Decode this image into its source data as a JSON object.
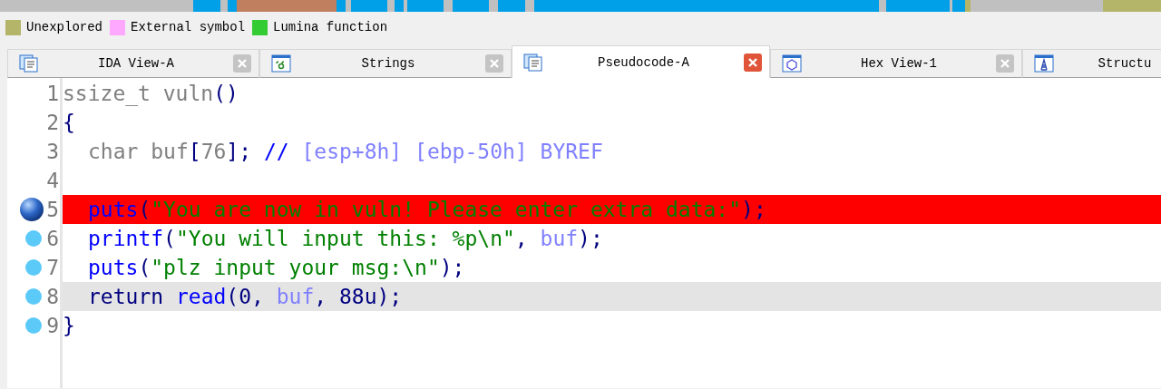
{
  "legend": [
    {
      "label": "Unexplored",
      "color": "#b5b56a"
    },
    {
      "label": "External symbol",
      "color": "#ffa8ff"
    },
    {
      "label": "Lumina function",
      "color": "#33cc33"
    }
  ],
  "tabs": [
    {
      "label": "IDA View-A",
      "kind": "listing",
      "selected": false,
      "closable": true
    },
    {
      "label": "Strings",
      "kind": "strings",
      "selected": false,
      "closable": true
    },
    {
      "label": "Pseudocode-A",
      "kind": "listing",
      "selected": true,
      "closable": true
    },
    {
      "label": "Hex View-1",
      "kind": "hex",
      "selected": false,
      "closable": true
    },
    {
      "label": "Structu",
      "kind": "structure",
      "selected": false,
      "closable": false
    }
  ],
  "code_lines": [
    {
      "number": "1",
      "kind": "plain",
      "selected": false,
      "indent": false,
      "tokens": [
        {
          "kind": "type",
          "text": "ssize_t vuln"
        },
        {
          "kind": "punct",
          "text": "()"
        }
      ]
    },
    {
      "number": "2",
      "kind": "plain",
      "selected": false,
      "indent": false,
      "tokens": [
        {
          "kind": "punct",
          "text": "{"
        }
      ]
    },
    {
      "number": "3",
      "kind": "plain",
      "selected": false,
      "indent": true,
      "tokens": [
        {
          "kind": "type",
          "text": "char buf"
        },
        {
          "kind": "punct",
          "text": "["
        },
        {
          "kind": "type",
          "text": "76"
        },
        {
          "kind": "punct",
          "text": "]; "
        },
        {
          "kind": "comment_mark",
          "text": "//"
        },
        {
          "kind": "comment",
          "text": " [esp+8h] [ebp-50h] BYREF"
        }
      ]
    },
    {
      "number": "4",
      "kind": "plain"
    },
    {
      "number": "5",
      "kind": "breakpoint",
      "selected": false,
      "indent": true,
      "tokens": [
        {
          "kind": "func",
          "text": "puts"
        },
        {
          "kind": "punct",
          "text": "("
        },
        {
          "kind": "string",
          "text": "\"You are now in vuln! Please enter extra data:\""
        },
        {
          "kind": "punct",
          "text": ");"
        }
      ]
    },
    {
      "number": "6",
      "kind": "executable",
      "selected": false,
      "indent": true,
      "tokens": [
        {
          "kind": "func",
          "text": "printf"
        },
        {
          "kind": "punct",
          "text": "("
        },
        {
          "kind": "string",
          "text": "\"You will input this: %p\\n\""
        },
        {
          "kind": "punct",
          "text": ", "
        },
        {
          "kind": "var",
          "text": "buf"
        },
        {
          "kind": "punct",
          "text": ");"
        }
      ]
    },
    {
      "number": "7",
      "kind": "executable",
      "selected": false,
      "indent": true,
      "tokens": [
        {
          "kind": "func",
          "text": "puts"
        },
        {
          "kind": "punct",
          "text": "("
        },
        {
          "kind": "string",
          "text": "\"plz input your msg:\\n\""
        },
        {
          "kind": "punct",
          "text": ");"
        }
      ]
    },
    {
      "number": "8",
      "kind": "executable",
      "selected": true,
      "indent": true,
      "tokens": [
        {
          "kind": "punct",
          "text": "return "
        },
        {
          "kind": "func",
          "text": "read"
        },
        {
          "kind": "punct",
          "text": "(0, "
        },
        {
          "kind": "var",
          "text": "buf"
        },
        {
          "kind": "punct",
          "text": ", 88u);"
        }
      ]
    },
    {
      "number": "9",
      "kind": "executable",
      "selected": false,
      "indent": false,
      "tokens": [
        {
          "kind": "punct",
          "text": "}"
        }
      ]
    }
  ]
}
